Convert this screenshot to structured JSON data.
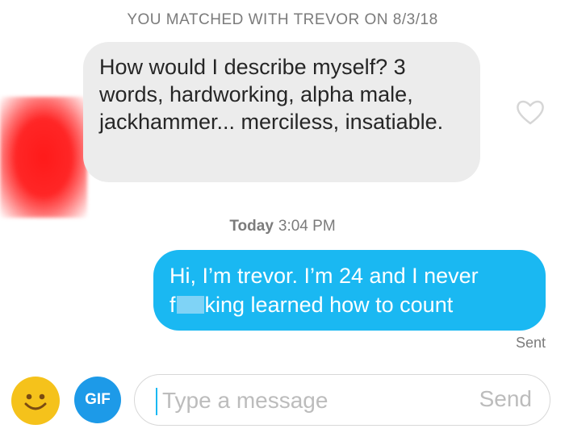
{
  "conversation": {
    "match_banner": "YOU MATCHED WITH TREVOR ON 8/3/18",
    "messages": [
      {
        "direction": "received",
        "text": "How would I describe myself? 3 words, hardworking, alpha male, jackhammer... merciless, insatiable."
      },
      {
        "direction": "sent",
        "text_line1": "Hi, I’m trevor. I’m 24 and I never",
        "text_line2_prefix": "f",
        "text_line2_suffix": "king learned how to count",
        "status": "Sent"
      }
    ],
    "timestamp": {
      "day": "Today",
      "time": "3:04 PM"
    }
  },
  "icons": {
    "like": "heart-outline-icon",
    "emoji": "smiley-face-icon"
  },
  "composer": {
    "gif_label": "GIF",
    "placeholder": "Type a message",
    "value": "",
    "send_label": "Send"
  },
  "colors": {
    "sent_bubble": "#1ab8f2",
    "received_bubble": "#ececec",
    "gif_button": "#1d9ae8",
    "emoji_button": "#f5c21b",
    "avatar_redaction": "#ff1a1a"
  }
}
